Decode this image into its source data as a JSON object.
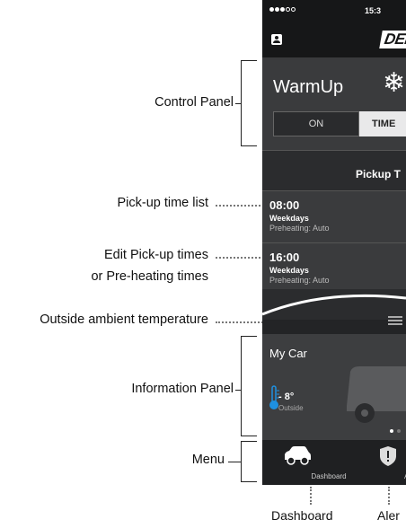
{
  "annotations": {
    "control_panel": "Control Panel",
    "pickup_list": "Pick-up time list",
    "edit_line1": "Edit Pick-up times",
    "edit_line2": "or Pre-heating times",
    "outside_temp": "Outside ambient temperature",
    "information_panel": "Information Panel",
    "menu": "Menu",
    "dashboard": "Dashboard",
    "alerts": "Aler"
  },
  "status_bar": {
    "time": "15:3"
  },
  "nav": {
    "brand": "DEF"
  },
  "control_panel": {
    "mode_title": "WarmUp",
    "on_label": "ON",
    "timer_label": "TIME"
  },
  "pickup": {
    "header": "Pickup T",
    "rows": [
      {
        "time": "08:00",
        "days": "Weekdays",
        "preheat": "Preheating: Auto"
      },
      {
        "time": "16:00",
        "days": "Weekdays",
        "preheat": "Preheating: Auto"
      }
    ]
  },
  "info_panel": {
    "car_name": "My Car",
    "temperature": "- 8°",
    "temperature_label": "Outside"
  },
  "menu": {
    "dashboard_label": "Dashboard",
    "alerts_label": "Alert"
  },
  "colors": {
    "phone_bg": "#2b2c2e",
    "panel_bg": "#3a3b3d",
    "thermometer": "#1e90e0"
  }
}
